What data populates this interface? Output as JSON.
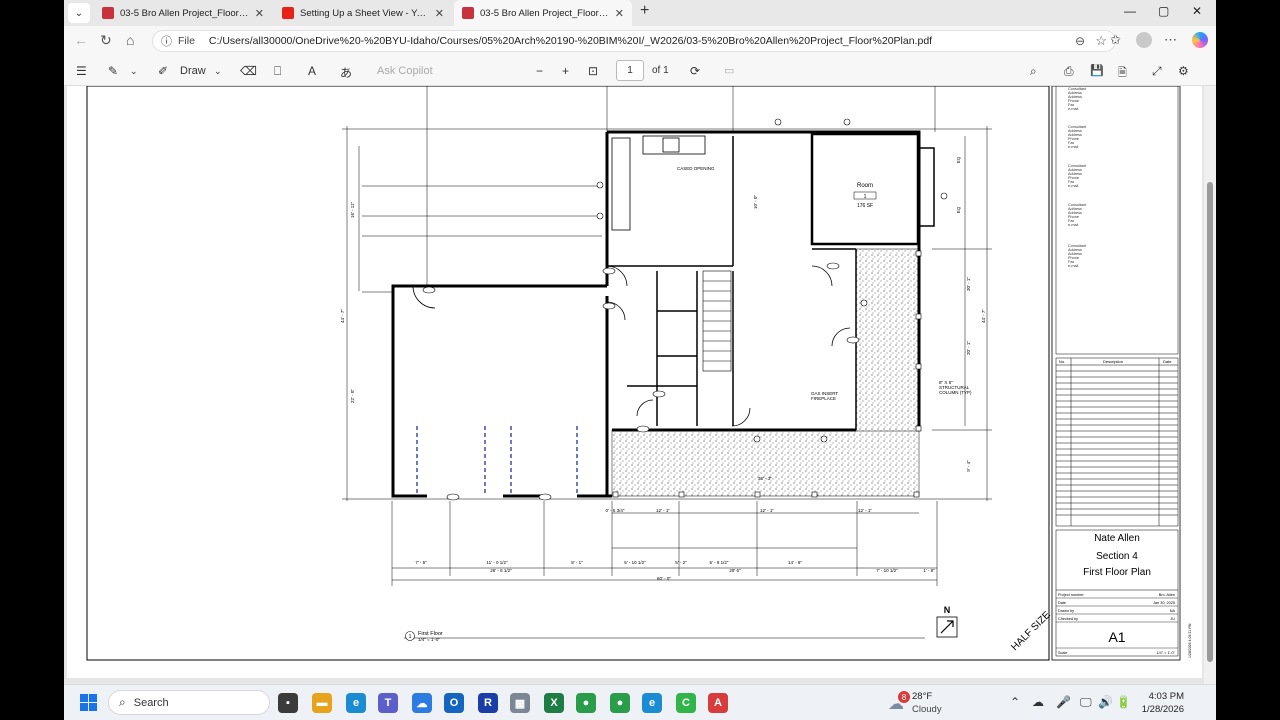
{
  "tabs": [
    {
      "title": "03-5 Bro Allen Project_Floor Plan.pdf",
      "close": "✕",
      "color": "#c8323c"
    },
    {
      "title": "Setting Up a Sheet View - YouTube",
      "close": "✕",
      "color": "#e62117"
    },
    {
      "title": "03-5 Bro Allen Project_Floor Plan.pdf",
      "close": "✕",
      "color": "#c8323c"
    }
  ],
  "tabstrip": {
    "menu": "⌄",
    "new_tab": "+",
    "minimize": "—",
    "maximize": "▢",
    "close": "✕"
  },
  "address": {
    "back": "←",
    "refresh": "↻",
    "home": "⌂",
    "info_icon": "ⓘ",
    "scheme": "File",
    "url": "C:/Users/all30000/OneDrive%20-%20BYU-Idaho/Courses/05%20Arch%20190-%20BIM%20I/_W2026/03-5%20Bro%20Allen%20Project_Floor%20Plan.pdf",
    "zoom_icon": "⊖",
    "star_icon": "☆",
    "favorites_icon": "✩",
    "collections_icon": "⧉",
    "more_icon": "⋯"
  },
  "pdf_toolbar": {
    "contents": "☰",
    "highlight": "✎",
    "chev": "⌄",
    "draw_icon": "✐",
    "draw_label": "Draw",
    "erase": "⌫",
    "text_box": "⎕",
    "read_aloud": "A",
    "translate": "あ",
    "ask_copilot": "Ask Copilot",
    "zoom_out": "−",
    "zoom_in": "+",
    "fit": "⊡",
    "page_number": "1",
    "page_total": "of 1",
    "rotate": "⟳",
    "two_page": "▭",
    "search": "⌕",
    "print": "⎙",
    "save": "💾",
    "save_as": "🗎",
    "fullscreen": "⤢",
    "settings": "⚙"
  },
  "drawing": {
    "consultants": [
      [
        "Consultant",
        "Address",
        "Address",
        "Phone",
        "Fax",
        "e-mail"
      ],
      [
        "Consultant",
        "Address",
        "Address",
        "Phone",
        "Fax",
        "e-mail"
      ],
      [
        "Consultant",
        "Address",
        "Address",
        "Phone",
        "Fax",
        "e-mail"
      ],
      [
        "Consultant",
        "Address",
        "Address",
        "Phone",
        "Fax",
        "e-mail"
      ],
      [
        "Consultant",
        "Address",
        "Address",
        "Phone",
        "Fax",
        "e-mail"
      ]
    ],
    "revision_headers": [
      "No.",
      "Description",
      "Date"
    ],
    "title_block": {
      "name": "Nate Allen",
      "section": "Section 4",
      "sheet_title": "First Floor Plan",
      "rows": [
        [
          "Project number",
          "Bro. Allen"
        ],
        [
          "Date",
          "Jan 30, 2025"
        ],
        [
          "Drawn by",
          "NA"
        ],
        [
          "Checked by",
          "JU"
        ]
      ],
      "sheet_number": "A1",
      "scale_label": "Scale",
      "scale_value": "1/4\" = 1'-0\"",
      "timestamp": "1/28/2026 4:03:21 PM"
    },
    "room_label": "Room",
    "room_number": "1",
    "room_area": "176 SF",
    "cased_opening": "CASED OPENING",
    "gas_insert_1": "GAS INSERT",
    "gas_insert_2": "FIREPLACE",
    "column_1": "8\" X 8\"",
    "column_2": "STRUCTURAL",
    "column_3": "COLUMN (TYP)",
    "view_number": "1",
    "view_title": "First Floor",
    "view_scale": "1/4\" = 1'-0\"",
    "north": "N",
    "half_size": "HALF SIZE",
    "dims_bottom_1": [
      "7' - 5\"",
      "11' - 0 1/2\"",
      "8' - 1\"",
      "5' - 10 1/2\"",
      "5' - 2\"",
      "5' - 9 1/2\"",
      "14' - 8\"",
      "7' - 10 1/2\"",
      "1' - 8\""
    ],
    "dims_bottom_2": [
      "26' - 6 1/2\"",
      "29' 6\""
    ],
    "dims_overall": "60' - 0\"",
    "dims_right": [
      "44' - 7\"",
      "30' - 1\"",
      "20' - 1\"",
      "9' - 4\""
    ],
    "dims_left": [
      "44' - 7\"",
      "22' - 0\"",
      "16' - 11\""
    ],
    "dims_misc": [
      "36' - 3\"",
      "12' - 1\"",
      "12' - 1\"",
      "12' - 1\"",
      "0' - 5 3/4\"",
      "EQ",
      "EQ",
      "10' - 0\""
    ]
  },
  "taskbar": {
    "search_icon": "⌕",
    "search_label": "Search",
    "weather_icon": "☁",
    "weather_badge": "8",
    "temperature": "28°F",
    "condition": "Cloudy",
    "time": "4:03 PM",
    "date": "1/28/2026",
    "tray": [
      "⌃",
      "☁",
      "🎤",
      "🖵",
      "🔊",
      "🔋"
    ],
    "apps": [
      {
        "glyph": "▪",
        "color": "#3b3b3b"
      },
      {
        "glyph": "▬",
        "color": "#e8a31c"
      },
      {
        "glyph": "e",
        "color": "#1b8bd2"
      },
      {
        "glyph": "T",
        "color": "#5b5fc7"
      },
      {
        "glyph": "☁",
        "color": "#2c7be0"
      },
      {
        "glyph": "O",
        "color": "#1565c0"
      },
      {
        "glyph": "R",
        "color": "#1a3ea8"
      },
      {
        "glyph": "▦",
        "color": "#7b8794"
      },
      {
        "glyph": "X",
        "color": "#1e7d45"
      },
      {
        "glyph": "●",
        "color": "#2a9d4b"
      },
      {
        "glyph": "●",
        "color": "#2a9d4b"
      },
      {
        "glyph": "e",
        "color": "#1b8bd2"
      },
      {
        "glyph": "C",
        "color": "#31b54a"
      },
      {
        "glyph": "A",
        "color": "#d83b3b"
      }
    ]
  }
}
